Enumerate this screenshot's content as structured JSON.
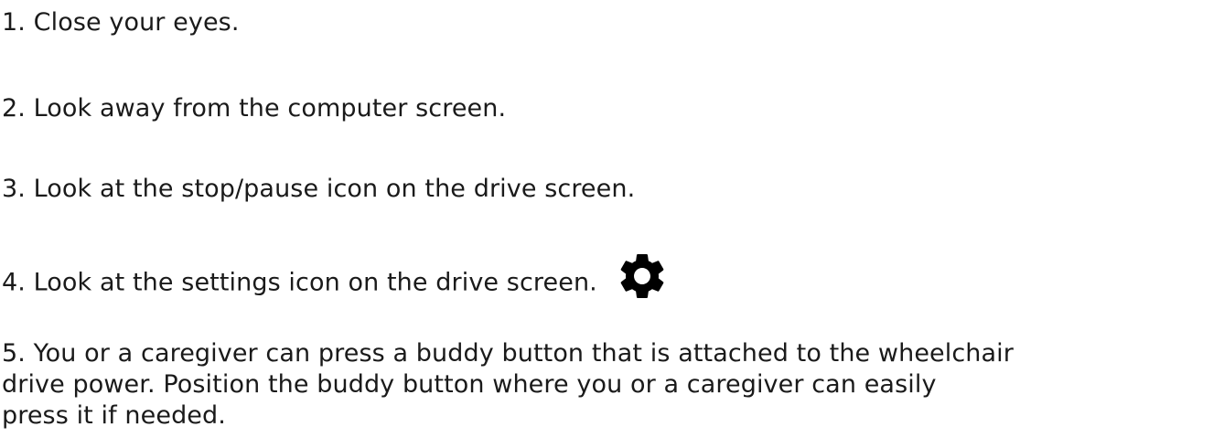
{
  "steps": [
    {
      "text": "1.  Close your eyes."
    },
    {
      "text": "2. Look away from the computer screen."
    },
    {
      "text": "3.  Look at the stop/pause icon on the drive screen."
    },
    {
      "text": "4.  Look at the settings icon on the drive screen.",
      "icon": "gear-icon"
    },
    {
      "lines": [
        "5. You or a caregiver can press a buddy button that is attached to the wheelchair",
        "drive power.  Position the buddy button where you or a caregiver can easily",
        "press it if needed."
      ]
    }
  ],
  "colors": {
    "text": "#1a1a1a",
    "icon": "#000000",
    "background": "#ffffff"
  }
}
